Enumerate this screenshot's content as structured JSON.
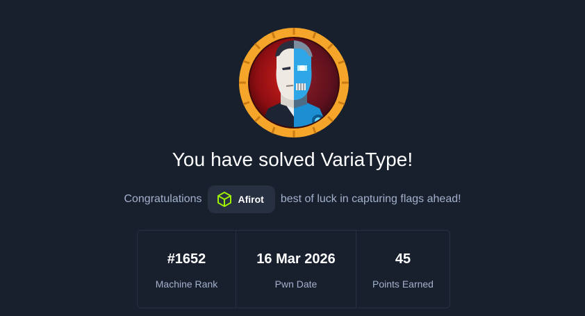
{
  "title": "You have solved VariaType!",
  "congrats": {
    "prefix": "Congratulations",
    "username": "Afirot",
    "suffix": "best of luck in capturing flags ahead!"
  },
  "stats": [
    {
      "value": "#1652",
      "label": "Machine Rank"
    },
    {
      "value": "16 Mar 2026",
      "label": "Pwn Date"
    },
    {
      "value": "45",
      "label": "Points Earned"
    }
  ],
  "colors": {
    "background": "#18202e",
    "ring": "#f5a62a",
    "accent_green": "#9fef00",
    "muted_text": "#a4b1cd",
    "chip_bg": "#263041"
  },
  "icons": {
    "avatar": "machine-avatar-icon",
    "user_badge": "htb-cube-icon"
  }
}
